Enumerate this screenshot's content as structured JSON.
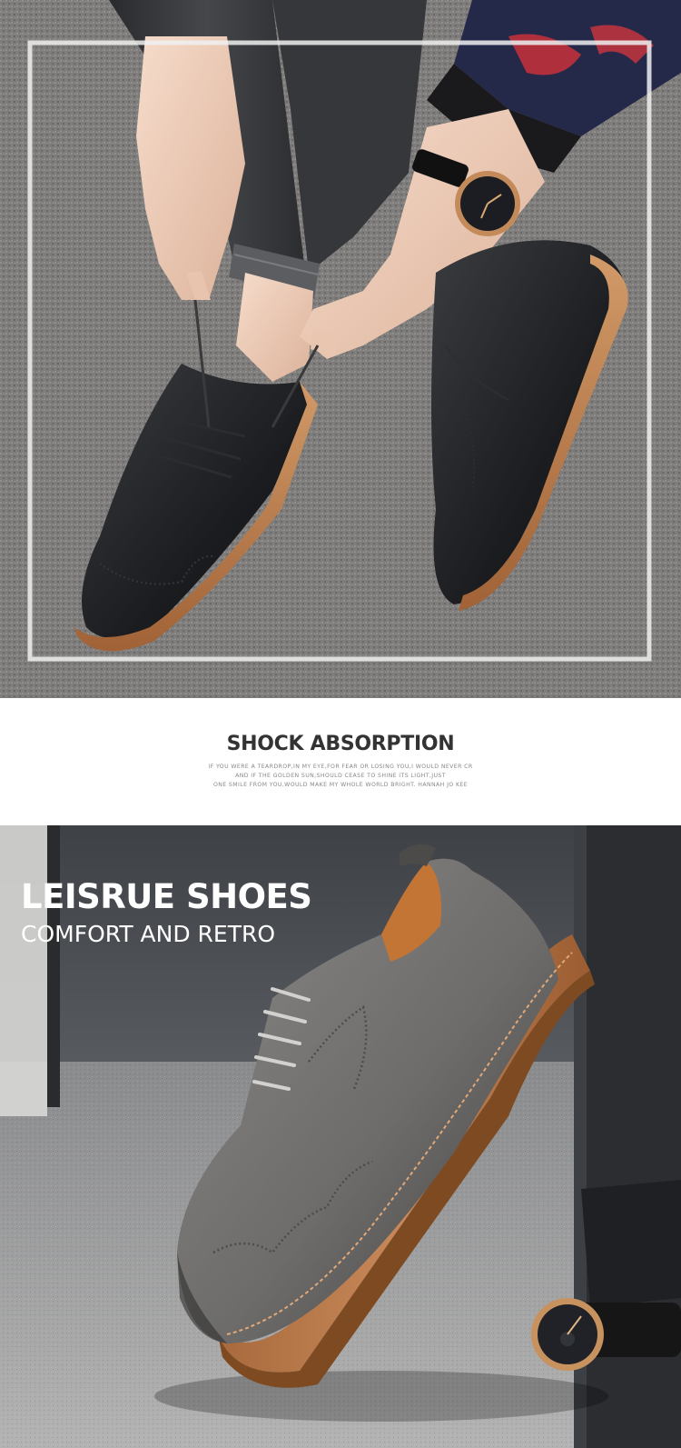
{
  "top_photo": {
    "subject": "man-tying-black-brogue-shoes"
  },
  "section": {
    "title": "SHOCK ABSORPTION",
    "quote_lines": [
      "IF YOU WERE A TEARDROP,IN MY EYE,FOR FEAR OR LOSING YOU,I WOULD NEVER CR",
      "AND IF THE GOLDEN SUN,SHOULD CEASE TO SHINE ITS LIGHT,JUST",
      "ONE SMILE FROM YOU,WOULD MAKE MY WHOLE WORLD BRIGHT. HANNAH JO KEE"
    ]
  },
  "bottom_photo": {
    "subject": "grey-brogue-shoe-with-watch",
    "title": "LEISRUE SHOES",
    "subtitle": "COMFORT AND RETRO"
  },
  "colors": {
    "text_dark": "#333333",
    "text_light": "#ffffff",
    "sole": "#b8784a",
    "leather_black": "#1e2024",
    "leather_grey": "#6f6e6c",
    "carpet": "#8a8886"
  }
}
